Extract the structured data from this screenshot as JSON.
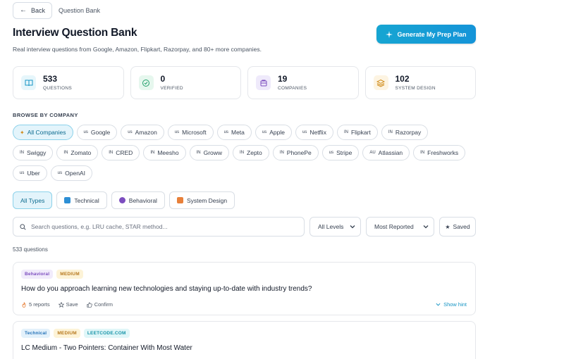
{
  "breadcrumb": {
    "back_label": "Back",
    "current": "Question Bank"
  },
  "header": {
    "title": "Interview Question Bank",
    "subtitle": "Real interview questions from Google, Amazon, Flipkart, Razorpay, and 80+ more companies.",
    "cta_label": "Generate My Prep Plan"
  },
  "stats": [
    {
      "value": "533",
      "label": "QUESTIONS",
      "icon": "book-icon",
      "color": "#e6f6fb"
    },
    {
      "value": "0",
      "label": "VERIFIED",
      "icon": "check-circle-icon",
      "color": "#e6f7ee"
    },
    {
      "value": "19",
      "label": "COMPANIES",
      "icon": "building-icon",
      "color": "#efeafb"
    },
    {
      "value": "102",
      "label": "SYSTEM DESIGN",
      "icon": "layers-icon",
      "color": "#fdf4e2"
    }
  ],
  "companies": {
    "section_label": "BROWSE BY COMPANY",
    "row1": [
      {
        "label": "All Companies",
        "cc": ""
      },
      {
        "label": "Google",
        "cc": "us"
      },
      {
        "label": "Amazon",
        "cc": "us"
      },
      {
        "label": "Microsoft",
        "cc": "us"
      },
      {
        "label": "Meta",
        "cc": "us"
      },
      {
        "label": "Apple",
        "cc": "us"
      },
      {
        "label": "Netflix",
        "cc": "us"
      },
      {
        "label": "Flipkart",
        "cc": "IN"
      },
      {
        "label": "Razorpay",
        "cc": "IN"
      }
    ],
    "row2": [
      {
        "label": "Swiggy",
        "cc": "IN"
      },
      {
        "label": "Zomato",
        "cc": "IN"
      },
      {
        "label": "CRED",
        "cc": "IN"
      },
      {
        "label": "Meesho",
        "cc": "IN"
      },
      {
        "label": "Groww",
        "cc": "IN"
      },
      {
        "label": "Zepto",
        "cc": "IN"
      },
      {
        "label": "PhonePe",
        "cc": "IN"
      },
      {
        "label": "Stripe",
        "cc": "us"
      },
      {
        "label": "Atlassian",
        "cc": "AU"
      },
      {
        "label": "Freshworks",
        "cc": "IN"
      }
    ],
    "row3": [
      {
        "label": "Uber",
        "cc": "us"
      },
      {
        "label": "OpenAI",
        "cc": "us"
      }
    ]
  },
  "types": {
    "all": "All Types",
    "technical": "Technical",
    "behavioral": "Behavioral",
    "system_design": "System Design"
  },
  "filters": {
    "search_placeholder": "Search questions, e.g. LRU cache, STAR method...",
    "level": "All Levels",
    "sort": "Most Reported",
    "saved": "Saved"
  },
  "results_count": "533 questions",
  "questions": [
    {
      "tags": [
        "Behavioral",
        "MEDIUM"
      ],
      "text": "How do you approach learning new technologies and staying up-to-date with industry trends?",
      "reports": "5 reports",
      "save": "Save",
      "confirm": "Confirm",
      "hint": "Show hint"
    },
    {
      "tags": [
        "Technical",
        "MEDIUM",
        "LEETCODE.COM"
      ],
      "text": "LC Medium - Two Pointers: Container With Most Water"
    }
  ],
  "colors": {
    "accent": "#1594d8",
    "active_chip_bg": "#e3f4fb"
  }
}
